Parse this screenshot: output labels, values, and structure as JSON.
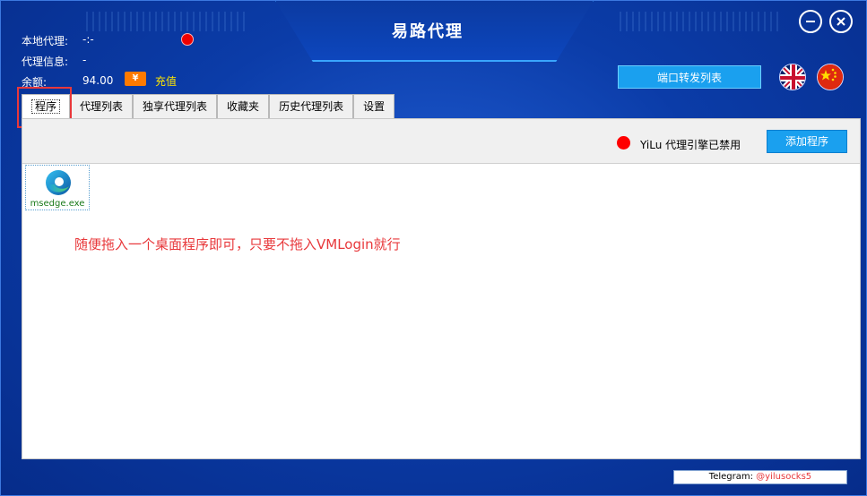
{
  "window": {
    "title": "易路代理",
    "minimize_icon": "minimize-icon",
    "close_icon": "close-icon"
  },
  "info": {
    "local_proxy_label": "本地代理:",
    "local_proxy_value": "-:-",
    "proxy_info_label": "代理信息:",
    "proxy_info_value": "-",
    "balance_label": "余额:",
    "balance_value": "94.00",
    "recharge_icon": "¥",
    "recharge_label": "充值",
    "status_color": "#f00000"
  },
  "header": {
    "port_forward_button": "端口转发列表",
    "lang_en_icon": "uk-flag-icon",
    "lang_cn_icon": "china-flag-icon"
  },
  "tabs": [
    {
      "label": "程序",
      "active": true
    },
    {
      "label": "代理列表",
      "active": false
    },
    {
      "label": "独享代理列表",
      "active": false
    },
    {
      "label": "收藏夹",
      "active": false
    },
    {
      "label": "历史代理列表",
      "active": false
    },
    {
      "label": "设置",
      "active": false
    }
  ],
  "toolbar": {
    "engine_status": "YiLu 代理引擎已禁用",
    "engine_status_color": "#ff0000",
    "add_program_button": "添加程序"
  },
  "programs": [
    {
      "name": "msedge.exe",
      "icon": "edge-browser-icon"
    }
  ],
  "hint_text": "随便拖入一个桌面程序即可，只要不拖入VMLogin就行",
  "footer": {
    "telegram_label": "Telegram: ",
    "telegram_handle": "@yilusocks5"
  },
  "colors": {
    "accent": "#1aa0ef",
    "background": "#0b3ca8",
    "hint": "#e8383b"
  }
}
